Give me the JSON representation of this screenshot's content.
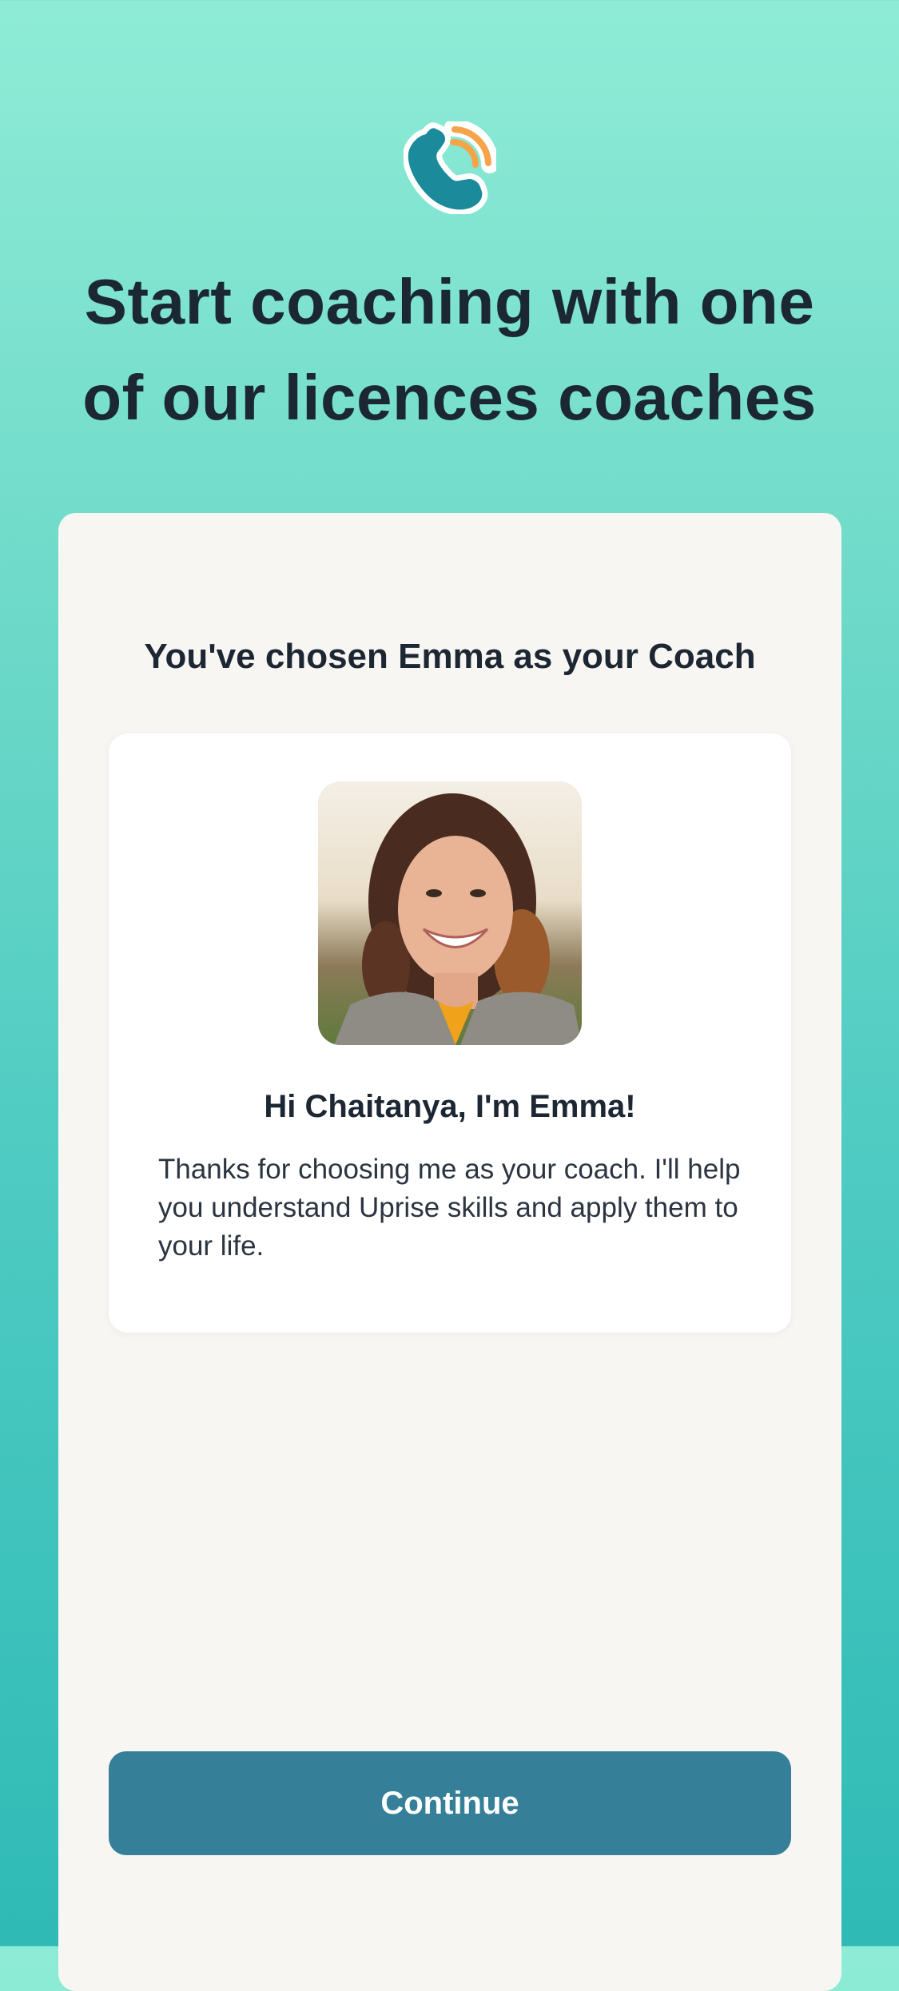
{
  "header": {
    "logo_icon": "phone-call-icon",
    "title": "Start coaching with one of our licences coaches"
  },
  "card": {
    "title": "You've chosen Emma as your Coach",
    "coach": {
      "avatar_icon": "coach-photo",
      "greeting": "Hi Chaitanya, I'm Emma!",
      "bio": "Thanks for choosing me as your coach. I'll help you understand Uprise skills and apply them to your life."
    },
    "continue_label": "Continue"
  },
  "colors": {
    "primary_button": "#367f99",
    "background_top": "#8eecd6",
    "background_bottom": "#2fbab6",
    "card_background": "#f7f6f3",
    "logo_teal": "#1b8a9a",
    "logo_orange": "#f5a44a"
  }
}
